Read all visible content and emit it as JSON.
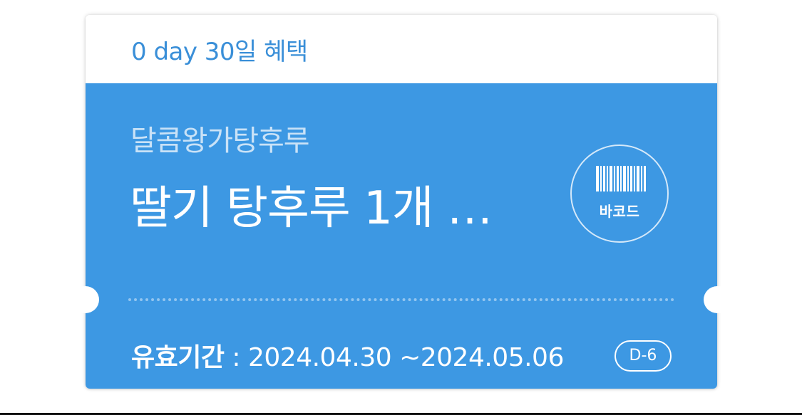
{
  "coupon": {
    "header_title": "0 day 30일 혜택",
    "brand": "달콤왕가탕후루",
    "product": "딸기 탕후루 1개 …",
    "barcode_label": "바코드",
    "barcode_icon": "barcode-icon",
    "validity_label": "유효기간",
    "validity_separator": " : ",
    "validity_range": "2024.04.30 ~2024.05.06",
    "dday": "D-6"
  },
  "colors": {
    "accent": "#3d98e3",
    "header_text": "#3a8fd8",
    "background": "#ffffff"
  }
}
